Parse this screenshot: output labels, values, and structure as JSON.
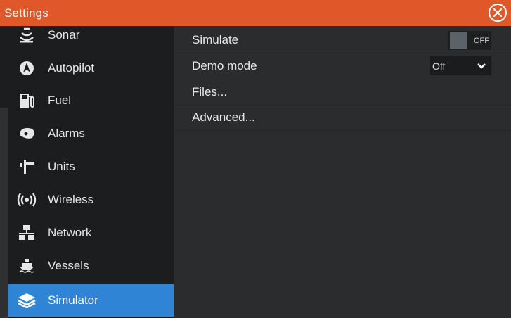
{
  "window": {
    "title": "Settings"
  },
  "sidebar": {
    "items": [
      {
        "label": "Sonar",
        "icon": "sonar-icon"
      },
      {
        "label": "Autopilot",
        "icon": "autopilot-icon"
      },
      {
        "label": "Fuel",
        "icon": "fuel-icon"
      },
      {
        "label": "Alarms",
        "icon": "alarm-bell-icon"
      },
      {
        "label": "Units",
        "icon": "ruler-icon"
      },
      {
        "label": "Wireless",
        "icon": "wireless-icon"
      },
      {
        "label": "Network",
        "icon": "network-icon"
      },
      {
        "label": "Vessels",
        "icon": "vessel-icon"
      },
      {
        "label": "Simulator",
        "icon": "layers-icon",
        "active": true
      }
    ]
  },
  "main": {
    "simulate": {
      "label": "Simulate",
      "state": "OFF"
    },
    "demo_mode": {
      "label": "Demo mode",
      "value": "Off"
    },
    "files": {
      "label": "Files..."
    },
    "advanced": {
      "label": "Advanced..."
    }
  },
  "colors": {
    "titlebar": "#e0582a",
    "active": "#2f84d6",
    "sidebar": "#1c1d1e",
    "content": "#2b2c2d"
  }
}
